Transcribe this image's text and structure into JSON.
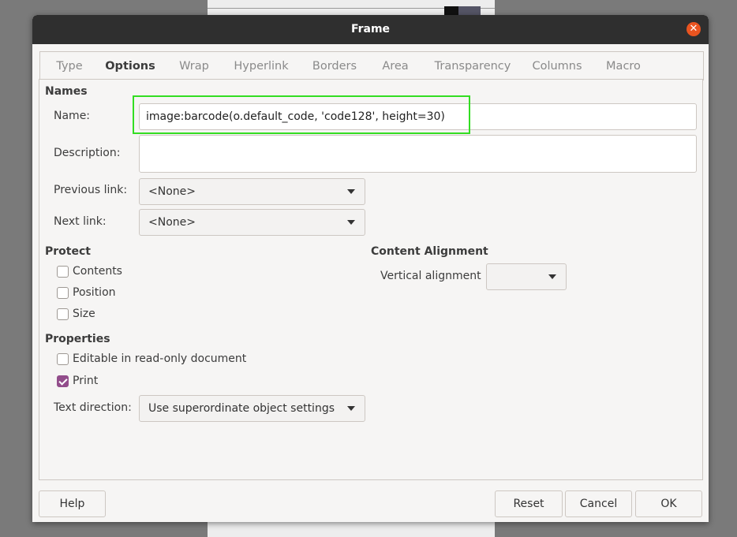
{
  "dialog": {
    "title": "Frame"
  },
  "tabs": [
    "Type",
    "Options",
    "Wrap",
    "Hyperlink",
    "Borders",
    "Area",
    "Transparency",
    "Columns",
    "Macro"
  ],
  "active_tab": "Options",
  "names": {
    "heading": "Names",
    "name_label": "Name:",
    "name_value": "image:barcode(o.default_code, 'code128', height=30)",
    "description_label": "Description:",
    "description_value": "",
    "previous_link_label": "Previous link:",
    "previous_link_value": "<None>",
    "next_link_label": "Next link:",
    "next_link_value": "<None>"
  },
  "protect": {
    "heading": "Protect",
    "options": [
      {
        "label": "Contents",
        "checked": false
      },
      {
        "label": "Position",
        "checked": false
      },
      {
        "label": "Size",
        "checked": false
      }
    ]
  },
  "content_alignment": {
    "heading": "Content Alignment",
    "vertical_label": "Vertical alignment",
    "vertical_value": ""
  },
  "properties": {
    "heading": "Properties",
    "editable_label": "Editable in read-only document",
    "editable_checked": false,
    "print_label": "Print",
    "print_checked": true,
    "text_direction_label": "Text direction:",
    "text_direction_value": "Use superordinate object settings"
  },
  "buttons": {
    "help": "Help",
    "reset": "Reset",
    "cancel": "Cancel",
    "ok": "OK"
  },
  "colors": {
    "accent": "#e95420",
    "highlight": "#33dd22",
    "checkbox_on": "#924d8b"
  }
}
